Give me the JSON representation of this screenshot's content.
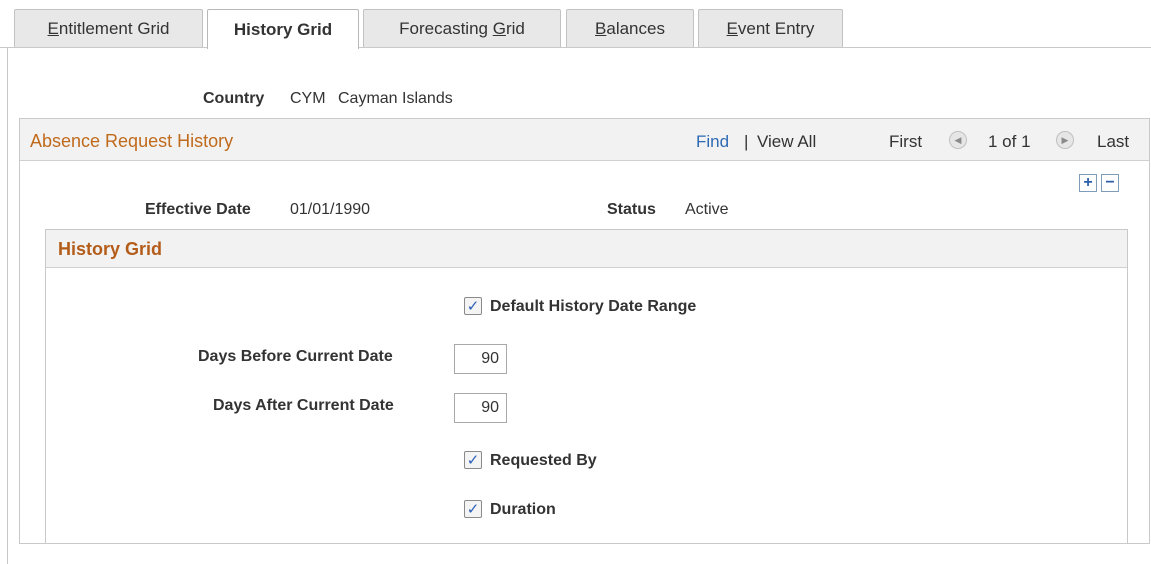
{
  "tabs": [
    {
      "prefix": "",
      "ul": "E",
      "rest": "ntitlement Grid",
      "active": false
    },
    {
      "prefix": "History Grid",
      "ul": "",
      "rest": "",
      "active": true
    },
    {
      "prefix": "Forecasting ",
      "ul": "G",
      "rest": "rid",
      "active": false
    },
    {
      "prefix": "",
      "ul": "B",
      "rest": "alances",
      "active": false
    },
    {
      "prefix": "",
      "ul": "E",
      "rest": "vent Entry",
      "active": false
    }
  ],
  "country": {
    "label": "Country",
    "code": "CYM",
    "name": "Cayman Islands"
  },
  "scroll_area": {
    "title": "Absence Request History",
    "find": "Find",
    "separator": "|",
    "view_all": "View All",
    "first": "First",
    "count": "1 of 1",
    "last": "Last",
    "add": "+",
    "remove": "−"
  },
  "effective_date": {
    "label": "Effective Date",
    "value": "01/01/1990"
  },
  "status": {
    "label": "Status",
    "value": "Active"
  },
  "history_grid": {
    "title": "History Grid",
    "default_range": {
      "label": "Default History Date Range",
      "checked": true
    },
    "days_before": {
      "label": "Days Before Current Date",
      "value": "90"
    },
    "days_after": {
      "label": "Days After Current Date",
      "value": "90"
    },
    "requested_by": {
      "label": "Requested By",
      "checked": true
    },
    "duration": {
      "label": "Duration",
      "checked": true
    }
  },
  "icons": {
    "prev": "arrow-left-icon",
    "next": "arrow-right-icon",
    "check": "checkmark-icon"
  }
}
